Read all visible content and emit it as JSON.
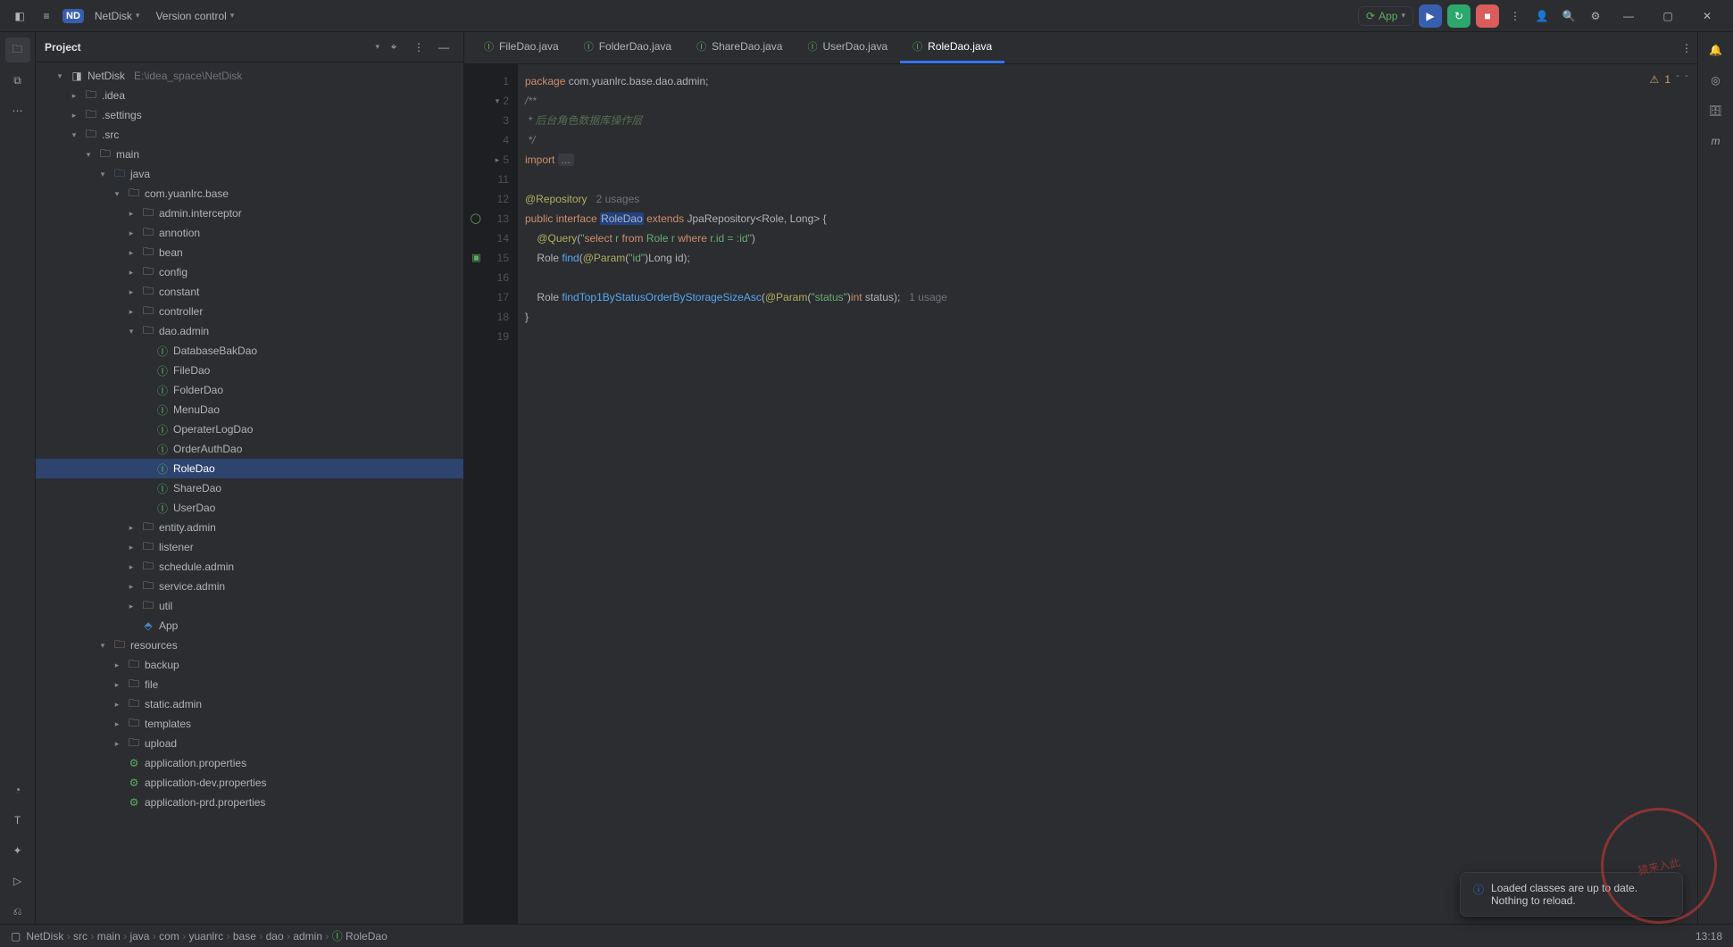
{
  "titlebar": {
    "project": "NetDisk",
    "vcs": "Version control",
    "run_config": "App"
  },
  "project_panel": {
    "title": "Project"
  },
  "project_root": {
    "name": "NetDisk",
    "path": "E:\\idea_space\\NetDisk"
  },
  "tree": [
    {
      "depth": 0,
      "arrow": "v",
      "icon": "proj",
      "label": "NetDisk",
      "dim": "E:\\idea_space\\NetDisk"
    },
    {
      "depth": 1,
      "arrow": ">",
      "icon": "folder",
      "label": ".idea"
    },
    {
      "depth": 1,
      "arrow": ">",
      "icon": "folder",
      "label": ".settings"
    },
    {
      "depth": 1,
      "arrow": "v",
      "icon": "folder",
      "label": ".src"
    },
    {
      "depth": 2,
      "arrow": "v",
      "icon": "folder",
      "label": "main"
    },
    {
      "depth": 3,
      "arrow": "v",
      "icon": "src",
      "label": "java"
    },
    {
      "depth": 4,
      "arrow": "v",
      "icon": "folder",
      "label": "com.yuanlrc.base"
    },
    {
      "depth": 5,
      "arrow": ">",
      "icon": "folder",
      "label": "admin.interceptor"
    },
    {
      "depth": 5,
      "arrow": ">",
      "icon": "folder",
      "label": "annotion"
    },
    {
      "depth": 5,
      "arrow": ">",
      "icon": "folder",
      "label": "bean"
    },
    {
      "depth": 5,
      "arrow": ">",
      "icon": "folder",
      "label": "config"
    },
    {
      "depth": 5,
      "arrow": ">",
      "icon": "folder",
      "label": "constant"
    },
    {
      "depth": 5,
      "arrow": ">",
      "icon": "folder",
      "label": "controller"
    },
    {
      "depth": 5,
      "arrow": "v",
      "icon": "folder",
      "label": "dao.admin"
    },
    {
      "depth": 6,
      "arrow": "",
      "icon": "intf",
      "label": "DatabaseBakDao"
    },
    {
      "depth": 6,
      "arrow": "",
      "icon": "intf",
      "label": "FileDao"
    },
    {
      "depth": 6,
      "arrow": "",
      "icon": "intf",
      "label": "FolderDao"
    },
    {
      "depth": 6,
      "arrow": "",
      "icon": "intf",
      "label": "MenuDao"
    },
    {
      "depth": 6,
      "arrow": "",
      "icon": "intf",
      "label": "OperaterLogDao"
    },
    {
      "depth": 6,
      "arrow": "",
      "icon": "intf",
      "label": "OrderAuthDao"
    },
    {
      "depth": 6,
      "arrow": "",
      "icon": "intf",
      "label": "RoleDao",
      "selected": true
    },
    {
      "depth": 6,
      "arrow": "",
      "icon": "intf",
      "label": "ShareDao"
    },
    {
      "depth": 6,
      "arrow": "",
      "icon": "intf",
      "label": "UserDao"
    },
    {
      "depth": 5,
      "arrow": ">",
      "icon": "folder",
      "label": "entity.admin"
    },
    {
      "depth": 5,
      "arrow": ">",
      "icon": "folder",
      "label": "listener"
    },
    {
      "depth": 5,
      "arrow": ">",
      "icon": "folder",
      "label": "schedule.admin"
    },
    {
      "depth": 5,
      "arrow": ">",
      "icon": "folder",
      "label": "service.admin"
    },
    {
      "depth": 5,
      "arrow": ">",
      "icon": "folder",
      "label": "util"
    },
    {
      "depth": 5,
      "arrow": "",
      "icon": "app",
      "label": "App"
    },
    {
      "depth": 3,
      "arrow": "v",
      "icon": "res",
      "label": "resources"
    },
    {
      "depth": 4,
      "arrow": ">",
      "icon": "folder",
      "label": "backup"
    },
    {
      "depth": 4,
      "arrow": ">",
      "icon": "folder",
      "label": "file"
    },
    {
      "depth": 4,
      "arrow": ">",
      "icon": "folder",
      "label": "static.admin"
    },
    {
      "depth": 4,
      "arrow": ">",
      "icon": "folder",
      "label": "templates"
    },
    {
      "depth": 4,
      "arrow": ">",
      "icon": "folder",
      "label": "upload"
    },
    {
      "depth": 4,
      "arrow": "",
      "icon": "cfg",
      "label": "application.properties"
    },
    {
      "depth": 4,
      "arrow": "",
      "icon": "cfg",
      "label": "application-dev.properties"
    },
    {
      "depth": 4,
      "arrow": "",
      "icon": "cfg",
      "label": "application-prd.properties"
    }
  ],
  "tabs": [
    {
      "label": "FileDao.java",
      "active": false
    },
    {
      "label": "FolderDao.java",
      "active": false
    },
    {
      "label": "ShareDao.java",
      "active": false
    },
    {
      "label": "UserDao.java",
      "active": false
    },
    {
      "label": "RoleDao.java",
      "active": true
    }
  ],
  "warnings": {
    "icon": "⚠",
    "count": "1"
  },
  "code_lines": [
    {
      "n": "1",
      "html": "<span class='kw'>package</span> <span class='pkg'>com.yuanlrc.base.dao.admin</span>;"
    },
    {
      "n": "2",
      "fold": "v",
      "html": "<span class='cm'>/**</span>"
    },
    {
      "n": "3",
      "html": "<span class='cm'> * </span><span class='cm-cn'>后台角色数据库操作层</span>"
    },
    {
      "n": "4",
      "html": "<span class='cm'> */</span>"
    },
    {
      "n": "5",
      "fold": ">",
      "html": "<span class='kw'>import</span> <span class='coll'>...</span>"
    },
    {
      "n": "11",
      "html": ""
    },
    {
      "n": "12",
      "html": "<span class='ann'>@Repository</span>   <span class='hint'>2 usages</span>"
    },
    {
      "n": "13",
      "mark": "◯",
      "html": "<span class='kw'>public interface</span> <span class='cls hl-box'>RoleDao</span> <span class='kw'>extends</span> <span class='cls'>JpaRepository</span>&lt;<span class='cls'>Role</span>, <span class='cls'>Long</span>&gt; {"
    },
    {
      "n": "14",
      "html": "    <span class='ann'>@Query</span>(<span class='str'>\"</span><span class='str-kw'>select</span><span class='str'> r </span><span class='str-kw'>from</span><span class='str'> Role r </span><span class='str-kw'>where</span><span class='str'> r.id = :id\"</span>)"
    },
    {
      "n": "15",
      "mark": "▣",
      "html": "    <span class='cls'>Role</span> <span class='fn'>find</span>(<span class='ann'>@Param</span>(<span class='str'>\"id\"</span>)<span class='cls'>Long</span> id);"
    },
    {
      "n": "16",
      "html": ""
    },
    {
      "n": "17",
      "html": "    <span class='cls'>Role</span> <span class='fn'>findTop1ByStatusOrderByStorageSizeAsc</span>(<span class='ann'>@Param</span>(<span class='str'>\"status\"</span>)<span class='kw'>int</span> status);   <span class='hint'>1 usage</span>"
    },
    {
      "n": "18",
      "html": "}"
    },
    {
      "n": "19",
      "html": ""
    }
  ],
  "breadcrumb": [
    "NetDisk",
    "src",
    "main",
    "java",
    "com",
    "yuanlrc",
    "base",
    "dao",
    "admin",
    "RoleDao"
  ],
  "toast": {
    "text": "Loaded classes are up to date. Nothing to reload."
  },
  "statusbar": {
    "time": "13:18"
  },
  "watermark": "猿来入此"
}
